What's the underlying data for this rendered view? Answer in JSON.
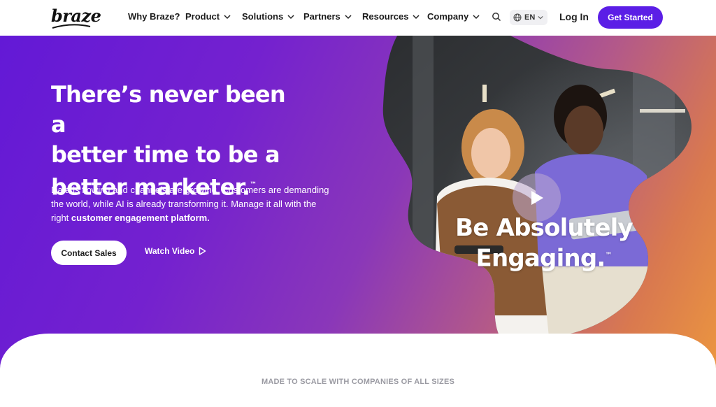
{
  "nav": {
    "logo": "braze",
    "items": [
      {
        "label": "Why Braze?",
        "dropdown": false
      },
      {
        "label": "Product",
        "dropdown": true
      },
      {
        "label": "Solutions",
        "dropdown": true
      },
      {
        "label": "Partners",
        "dropdown": true
      },
      {
        "label": "Resources",
        "dropdown": true
      },
      {
        "label": "Company",
        "dropdown": true
      }
    ],
    "language": "EN",
    "login": "Log In",
    "cta": "Get Started"
  },
  "hero": {
    "headline": [
      "There’s never been a",
      "better time to be a",
      "better marketer."
    ],
    "trademark": "™",
    "description": "Data is flowing and channels are growing. Customers are demanding the world, while AI is already transforming it. Manage it all with the right ",
    "description_bold": "customer engagement platform.",
    "contact_button": "Contact Sales",
    "watch_button": "Watch Video",
    "video_overlay": [
      "Be Absolutely",
      "Engaging."
    ],
    "overlay_trademark": "™"
  },
  "footer_band": {
    "label": "MADE TO SCALE WITH COMPANIES OF ALL SIZES"
  },
  "colors": {
    "brand_purple": "#5b1ee6",
    "gradient_start": "#6319d6",
    "gradient_end": "#ee9a3d"
  },
  "icons": [
    "chevron-down-icon",
    "search-icon",
    "globe-icon",
    "play-icon"
  ]
}
